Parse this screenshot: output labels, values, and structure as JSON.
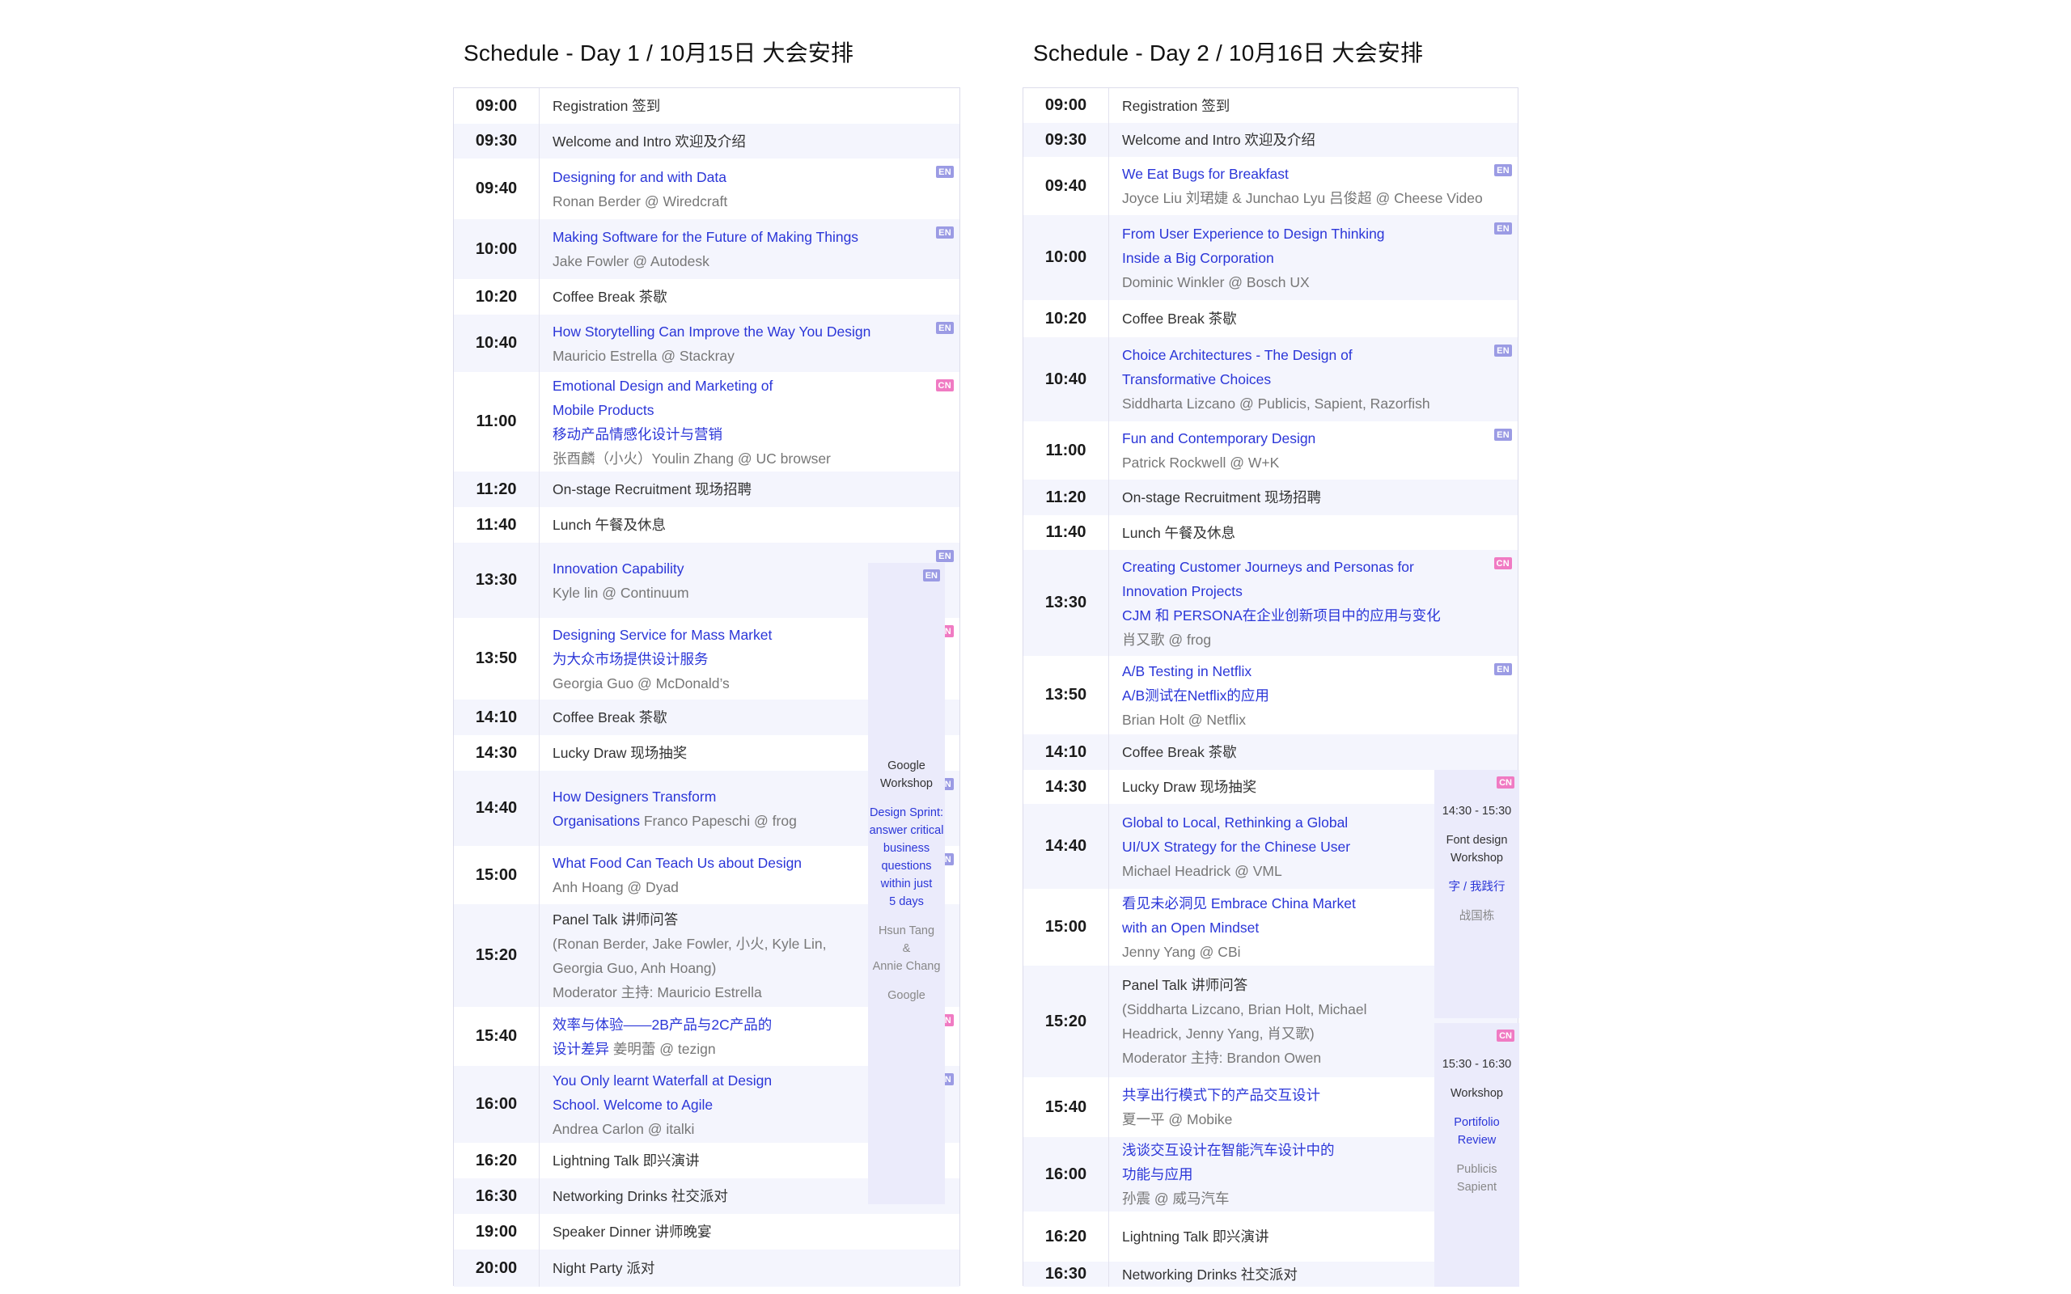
{
  "day1": {
    "title": "Schedule - Day 1 / 10月15日 大会安排",
    "rows": [
      {
        "time": "09:00",
        "lines": [
          {
            "t": "Registration 签到",
            "s": "plain"
          }
        ]
      },
      {
        "time": "09:30",
        "lines": [
          {
            "t": "Welcome and Intro 欢迎及介绍",
            "s": "plain"
          }
        ]
      },
      {
        "time": "09:40",
        "badge": "EN",
        "lines": [
          {
            "t": "Designing for and with Data",
            "s": "talk"
          },
          {
            "t": "Ronan Berder @ Wiredcraft",
            "s": "sp"
          }
        ]
      },
      {
        "time": "10:00",
        "badge": "EN",
        "lines": [
          {
            "t": "Making Software for the Future of Making Things",
            "s": "talk"
          },
          {
            "t": "Jake Fowler @ Autodesk",
            "s": "sp"
          }
        ]
      },
      {
        "time": "10:20",
        "lines": [
          {
            "t": "Coffee Break  茶歇",
            "s": "plain"
          }
        ]
      },
      {
        "time": "10:40",
        "badge": "EN",
        "lines": [
          {
            "t": "How Storytelling Can Improve the Way You Design",
            "s": "talk"
          },
          {
            "t": "Mauricio Estrella @ Stackray",
            "s": "sp"
          }
        ]
      },
      {
        "time": "11:00",
        "badge": "CN",
        "lines": [
          {
            "t": "Emotional Design and Marketing of",
            "s": "talk"
          },
          {
            "t": "Mobile Products",
            "s": "talk"
          },
          {
            "t": "移动产品情感化设计与营销",
            "s": "talk"
          },
          {
            "t": "张酉麟（小火）Youlin Zhang @ UC browser",
            "s": "sp"
          }
        ]
      },
      {
        "time": "11:20",
        "lines": [
          {
            "t": "On-stage Recruitment 现场招聘",
            "s": "plain"
          }
        ]
      },
      {
        "time": "11:40",
        "lines": [
          {
            "t": "Lunch 午餐及休息",
            "s": "plain"
          }
        ]
      },
      {
        "time": "13:30",
        "badge": "EN",
        "lines": [
          {
            "t": "Innovation Capability",
            "s": "talk"
          },
          {
            "t": "Kyle lin @ Continuum",
            "s": "sp"
          }
        ]
      },
      {
        "time": "13:50",
        "badge": "CN",
        "lines": [
          {
            "t": "Designing Service for Mass Market",
            "s": "talk"
          },
          {
            "t": "为大众市场提供设计服务",
            "s": "talk"
          },
          {
            "t": "Georgia Guo @ McDonald’s",
            "s": "sp"
          }
        ]
      },
      {
        "time": "14:10",
        "lines": [
          {
            "t": "Coffee Break  茶歇",
            "s": "plain"
          }
        ]
      },
      {
        "time": "14:30",
        "lines": [
          {
            "t": "Lucky Draw  现场抽奖",
            "s": "plain"
          }
        ]
      },
      {
        "time": "14:40",
        "badge": "EN",
        "lines": [
          {
            "t": "How Designers Transform",
            "s": "talk"
          },
          {
            "t": "Organisations",
            "s": "talk",
            "extra": "  Franco Papeschi @ frog"
          }
        ]
      },
      {
        "time": "15:00",
        "badge": "EN",
        "lines": [
          {
            "t": "What Food Can Teach Us about Design",
            "s": "talk"
          },
          {
            "t": "Anh Hoang @ Dyad",
            "s": "sp"
          }
        ]
      },
      {
        "time": "15:20",
        "lines": [
          {
            "t": "Panel Talk 讲师问答",
            "s": "plain"
          },
          {
            "t": "(Ronan Berder, Jake Fowler, 小火, Kyle Lin,",
            "s": "sp"
          },
          {
            "t": "Georgia Guo, Anh Hoang)",
            "s": "sp"
          },
          {
            "t": "Moderator 主持: Mauricio Estrella",
            "s": "sp"
          }
        ]
      },
      {
        "time": "15:40",
        "badge": "CN",
        "lines": [
          {
            "t": "效率与体验——2B产品与2C产品的",
            "s": "talk"
          },
          {
            "t": "设计差异",
            "s": "talk",
            "extra": "  姜明蕾 @ tezign"
          }
        ]
      },
      {
        "time": "16:00",
        "badge": "EN",
        "lines": [
          {
            "t": "You Only learnt Waterfall at Design",
            "s": "talk"
          },
          {
            "t": "School. Welcome to Agile",
            "s": "talk"
          },
          {
            "t": "Andrea Carlon @ italki",
            "s": "sp"
          }
        ]
      },
      {
        "time": "16:20",
        "lines": [
          {
            "t": "Lightning Talk  即兴演讲",
            "s": "plain"
          }
        ]
      },
      {
        "time": "16:30",
        "lines": [
          {
            "t": "Networking Drinks  社交派对",
            "s": "plain"
          }
        ]
      },
      {
        "time": "19:00",
        "lines": [
          {
            "t": "Speaker Dinner  讲师晚宴",
            "s": "plain"
          }
        ]
      },
      {
        "time": "20:00",
        "lines": [
          {
            "t": "Night Party  派对",
            "s": "plain"
          }
        ]
      }
    ],
    "workshops": [
      {
        "badge": "EN",
        "lines": [
          {
            "t": "Google",
            "s": "dark"
          },
          {
            "t": "Workshop",
            "s": "dark"
          },
          {
            "t": "",
            "s": "dark"
          },
          {
            "t": "Design Sprint:",
            "s": "blue"
          },
          {
            "t": "answer critical",
            "s": "blue"
          },
          {
            "t": "business",
            "s": "blue"
          },
          {
            "t": "questions",
            "s": "blue"
          },
          {
            "t": "within just",
            "s": "blue"
          },
          {
            "t": "5 days",
            "s": "blue"
          },
          {
            "t": "",
            "s": "dark"
          },
          {
            "t": "Hsun Tang",
            "s": "grey"
          },
          {
            "t": "&",
            "s": "grey"
          },
          {
            "t": "Annie Chang",
            "s": "grey"
          },
          {
            "t": "",
            "s": "dark"
          },
          {
            "t": "Google",
            "s": "grey"
          }
        ]
      }
    ]
  },
  "day2": {
    "title": "Schedule - Day 2 / 10月16日 大会安排",
    "rows": [
      {
        "time": "09:00",
        "lines": [
          {
            "t": "Registration 签到",
            "s": "plain"
          }
        ]
      },
      {
        "time": "09:30",
        "lines": [
          {
            "t": "Welcome and Intro 欢迎及介绍",
            "s": "plain"
          }
        ]
      },
      {
        "time": "09:40",
        "badge": "EN",
        "lines": [
          {
            "t": "We Eat Bugs for Breakfast",
            "s": "talk"
          },
          {
            "t": "Joyce Liu 刘珺婕 & Junchao Lyu 吕俊超 @ Cheese Video",
            "s": "sp"
          }
        ]
      },
      {
        "time": "10:00",
        "badge": "EN",
        "lines": [
          {
            "t": "From User Experience to Design Thinking",
            "s": "talk"
          },
          {
            "t": "Inside a Big Corporation",
            "s": "talk"
          },
          {
            "t": "Dominic Winkler @ Bosch UX",
            "s": "sp"
          }
        ]
      },
      {
        "time": "10:20",
        "lines": [
          {
            "t": "Coffee Break  茶歇",
            "s": "plain"
          }
        ]
      },
      {
        "time": "10:40",
        "badge": "EN",
        "lines": [
          {
            "t": "Choice Architectures - The Design of",
            "s": "talk"
          },
          {
            "t": "Transformative Choices",
            "s": "talk"
          },
          {
            "t": "Siddharta Lizcano @ Publicis, Sapient, Razorfish",
            "s": "sp"
          }
        ]
      },
      {
        "time": "11:00",
        "badge": "EN",
        "lines": [
          {
            "t": "Fun and Contemporary Design",
            "s": "talk"
          },
          {
            "t": "Patrick Rockwell @ W+K",
            "s": "sp"
          }
        ]
      },
      {
        "time": "11:20",
        "lines": [
          {
            "t": "On-stage Recruitment 现场招聘",
            "s": "plain"
          }
        ]
      },
      {
        "time": "11:40",
        "lines": [
          {
            "t": "Lunch 午餐及休息",
            "s": "plain"
          }
        ]
      },
      {
        "time": "13:30",
        "badge": "CN",
        "lines": [
          {
            "t": "Creating Customer Journeys and Personas for",
            "s": "talk"
          },
          {
            "t": "Innovation Projects",
            "s": "talk"
          },
          {
            "t": "CJM 和 PERSONA在企业创新项目中的应用与变化",
            "s": "talk"
          },
          {
            "t": "肖又歌 @ frog",
            "s": "sp"
          }
        ]
      },
      {
        "time": "13:50",
        "badge": "EN",
        "lines": [
          {
            "t": "A/B Testing in Netflix",
            "s": "talk"
          },
          {
            "t": "A/B测试在Netflix的应用",
            "s": "talk"
          },
          {
            "t": "Brian Holt @ Netflix",
            "s": "sp"
          }
        ]
      },
      {
        "time": "14:10",
        "lines": [
          {
            "t": "Coffee Break  茶歇",
            "s": "plain"
          }
        ]
      },
      {
        "time": "14:30",
        "lines": [
          {
            "t": "Lucky Draw  现场抽奖",
            "s": "plain"
          }
        ]
      },
      {
        "time": "14:40",
        "badge": "EN",
        "lines": [
          {
            "t": "Global to Local, Rethinking a Global",
            "s": "talk"
          },
          {
            "t": "UI/UX Strategy for the Chinese User",
            "s": "talk"
          },
          {
            "t": "Michael Headrick @ VML",
            "s": "sp"
          }
        ]
      },
      {
        "time": "15:00",
        "badge": "CN",
        "lines": [
          {
            "t": "看见未必洞见 Embrace China Market",
            "s": "talk"
          },
          {
            "t": "with an Open Mindset",
            "s": "talk"
          },
          {
            "t": "Jenny Yang @ CBi",
            "s": "sp"
          }
        ]
      },
      {
        "time": "15:20",
        "lines": [
          {
            "t": "Panel Talk 讲师问答",
            "s": "plain"
          },
          {
            "t": "(Siddharta Lizcano, Brian Holt, Michael",
            "s": "sp"
          },
          {
            "t": "Headrick, Jenny Yang, 肖又歌)",
            "s": "sp"
          },
          {
            "t": "Moderator 主持: Brandon Owen",
            "s": "sp"
          }
        ]
      },
      {
        "time": "15:40",
        "badge": "CN",
        "lines": [
          {
            "t": "共享出行模式下的产品交互设计",
            "s": "talk"
          },
          {
            "t": "夏一平 @ Mobike",
            "s": "sp"
          }
        ]
      },
      {
        "time": "16:00",
        "badge": "CN",
        "lines": [
          {
            "t": "浅谈交互设计在智能汽车设计中的",
            "s": "talk"
          },
          {
            "t": "功能与应用",
            "s": "talk"
          },
          {
            "t": "孙震 @ 威马汽车",
            "s": "sp"
          }
        ]
      },
      {
        "time": "16:20",
        "lines": [
          {
            "t": "Lightning Talk  即兴演讲",
            "s": "plain"
          }
        ]
      },
      {
        "time": "16:30",
        "lines": [
          {
            "t": "Networking Drinks  社交派对",
            "s": "plain"
          }
        ]
      }
    ],
    "workshops": [
      {
        "badge": "CN",
        "lines": [
          {
            "t": "",
            "s": "dark"
          },
          {
            "t": "14:30 - 15:30",
            "s": "dark"
          },
          {
            "t": "",
            "s": "dark"
          },
          {
            "t": "Font design",
            "s": "dark"
          },
          {
            "t": "Workshop",
            "s": "dark"
          },
          {
            "t": "",
            "s": "dark"
          },
          {
            "t": "字 / 我践行",
            "s": "blue"
          },
          {
            "t": "",
            "s": "dark"
          },
          {
            "t": "战国栋",
            "s": "grey"
          }
        ]
      },
      {
        "badge": "CN",
        "lines": [
          {
            "t": "",
            "s": "dark"
          },
          {
            "t": "15:30 - 16:30",
            "s": "dark"
          },
          {
            "t": "",
            "s": "dark"
          },
          {
            "t": "Workshop",
            "s": "dark"
          },
          {
            "t": "",
            "s": "dark"
          },
          {
            "t": "Portifolio",
            "s": "blue"
          },
          {
            "t": "Review",
            "s": "blue"
          },
          {
            "t": "",
            "s": "dark"
          },
          {
            "t": "Publicis",
            "s": "grey"
          },
          {
            "t": "Sapient",
            "s": "grey"
          }
        ]
      }
    ]
  }
}
